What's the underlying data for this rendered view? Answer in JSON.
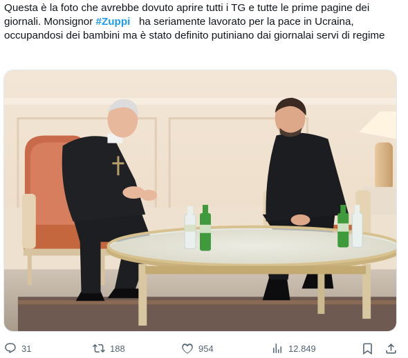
{
  "tweet": {
    "text_before": "Questa è la foto che avrebbe dovuto aprire tutti i TG e tutte le prime pagine dei giornali. Monsignor ",
    "hashtag": "#Zuppi",
    "text_after": "   ha seriamente lavorato per la pace in Ucraina, occupandosi dei bambini ma è stato definito putiniano dai giornalai servi di regime"
  },
  "actions": {
    "replies": "31",
    "reposts": "188",
    "likes": "954",
    "views": "12.849"
  },
  "icons": {
    "reply": "reply-bubble-icon",
    "repost": "repost-arrows-icon",
    "like": "heart-icon",
    "views": "bar-chart-icon",
    "bookmark": "bookmark-icon",
    "share": "share-upload-icon"
  },
  "colors": {
    "text": "#0f1419",
    "hashtag": "#1d9bf0",
    "muted": "#536471"
  }
}
